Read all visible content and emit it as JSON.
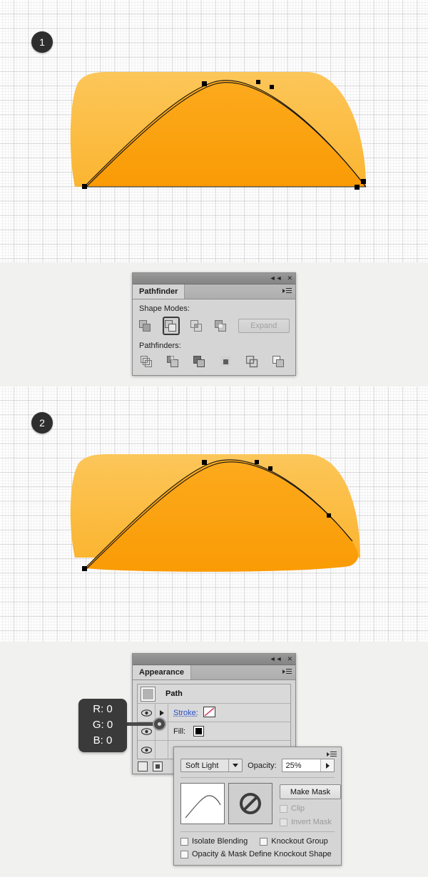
{
  "steps": [
    {
      "number": "1"
    },
    {
      "number": "2"
    }
  ],
  "pathfinder_panel": {
    "tab_label": "Pathfinder",
    "shape_modes_label": "Shape Modes:",
    "pathfinders_label": "Pathfinders:",
    "expand_label": "Expand",
    "collapse_icon": "collapse-double-arrow-icon",
    "close_icon": "close-icon",
    "menu_icon": "panel-menu-icon",
    "shape_modes": [
      {
        "name": "unite",
        "selected": false
      },
      {
        "name": "minus-front",
        "selected": true
      },
      {
        "name": "intersect",
        "selected": false
      },
      {
        "name": "exclude",
        "selected": false
      }
    ],
    "pathfinders": [
      {
        "name": "divide"
      },
      {
        "name": "trim"
      },
      {
        "name": "merge"
      },
      {
        "name": "crop"
      },
      {
        "name": "outline"
      },
      {
        "name": "minus-back"
      }
    ]
  },
  "appearance_panel": {
    "tab_label": "Appearance",
    "collapse_icon": "collapse-double-arrow-icon",
    "close_icon": "close-icon",
    "menu_icon": "panel-menu-icon",
    "object_label": "Path",
    "rows": [
      {
        "label": "Stroke:",
        "value": "",
        "eye": "eye-icon",
        "disclosure": "disclosure-triangle-icon",
        "swatch": "none-diagonal-swatch"
      },
      {
        "label": "Fill:",
        "value": "",
        "eye": "eye-icon",
        "swatch": "black-swatch"
      },
      {
        "label": "Opacity:",
        "value": "25% Soft Light",
        "eye": "eye-icon"
      }
    ],
    "footer_icons": [
      "new-art-has-basic-appearance-icon",
      "clear-appearance-icon"
    ]
  },
  "rgb_callout": {
    "r": "R: 0",
    "g": "G: 0",
    "b": "B: 0"
  },
  "transparency_panel": {
    "menu_icon": "panel-menu-icon",
    "blend_mode": "Soft Light",
    "blend_mode_caret": "chevron-down-icon",
    "opacity_label": "Opacity:",
    "opacity_value": "25%",
    "opacity_caret": "chevron-right-icon",
    "make_mask_label": "Make Mask",
    "clip_label": "Clip",
    "invert_mask_label": "Invert Mask",
    "isolate_blending_label": "Isolate Blending",
    "knockout_group_label": "Knockout Group",
    "knockout_shape_label": "Opacity & Mask Define Knockout Shape",
    "thumbnail_icon": "artwork-thumbnail",
    "mask_icon": "no-mask-icon"
  },
  "artwork": {
    "colors": {
      "light_orange": "#fbc04a",
      "mid_orange": "#fba81f",
      "dark_orange": "#fa9f0c",
      "path_stroke": "#1a1a1a",
      "anchor": "#000000"
    },
    "step1_caption": "dome shape with selected path and anchor points over lighter backdrop",
    "step2_caption": "dome shape after pathfinder minus-front operation"
  }
}
